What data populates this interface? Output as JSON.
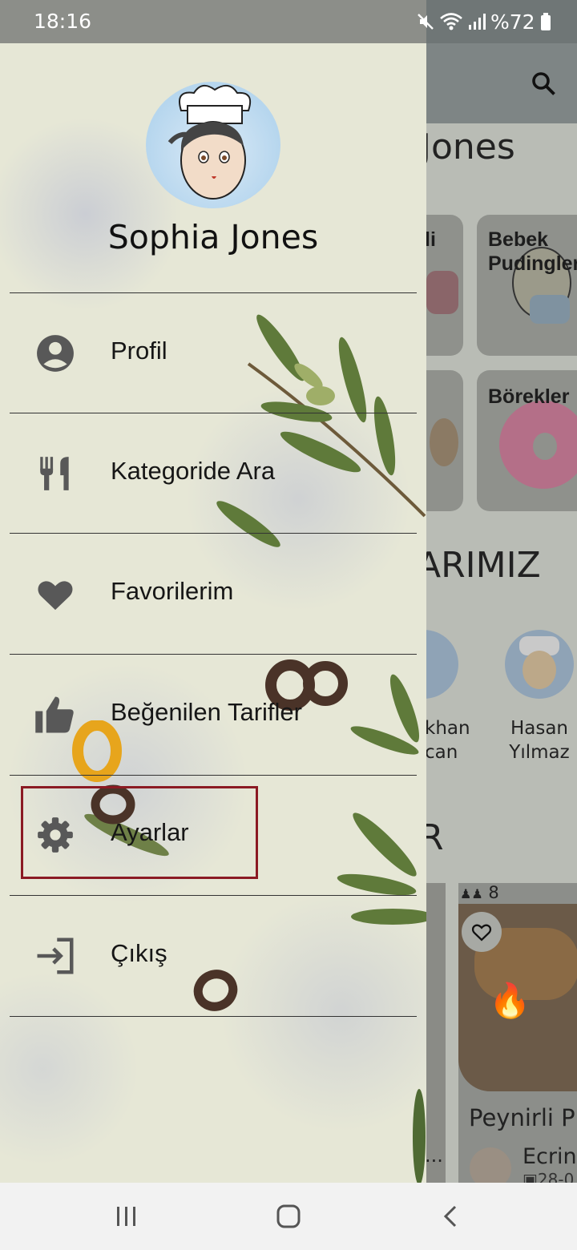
{
  "status_bar": {
    "time": "18:16",
    "battery": "%72"
  },
  "background": {
    "title_fragment": "Jones",
    "categories": [
      {
        "label": "li"
      },
      {
        "label": "Bebek Pudingler"
      },
      {
        "label": "Börekler"
      }
    ],
    "section_fragment": "ARIMIZ",
    "chefs": [
      {
        "name_line1": "khan",
        "name_line2": "can"
      },
      {
        "name_line1": "Hasan",
        "name_line2": "Yılmaz"
      }
    ],
    "section2_fragment": "R",
    "recipe": {
      "servings": "8",
      "title": "Peynirli P",
      "author": "Ecrin",
      "date": "28-0",
      "ellipsis": "..."
    }
  },
  "drawer": {
    "user_name": "Sophia Jones",
    "menu": [
      {
        "label": "Profil",
        "icon": "account-circle-icon"
      },
      {
        "label": "Kategoride Ara",
        "icon": "fork-knife-icon"
      },
      {
        "label": "Favorilerim",
        "icon": "heart-icon"
      },
      {
        "label": "Beğenilen Tarifler",
        "icon": "thumb-up-icon"
      },
      {
        "label": "Ayarlar",
        "icon": "gear-icon"
      },
      {
        "label": "Çıkış",
        "icon": "logout-icon"
      }
    ],
    "highlighted_item": "Ayarlar",
    "highlight_color": "#8b1a23"
  },
  "nav_bar": {
    "buttons": [
      "recent-apps-icon",
      "home-icon",
      "back-icon"
    ]
  }
}
